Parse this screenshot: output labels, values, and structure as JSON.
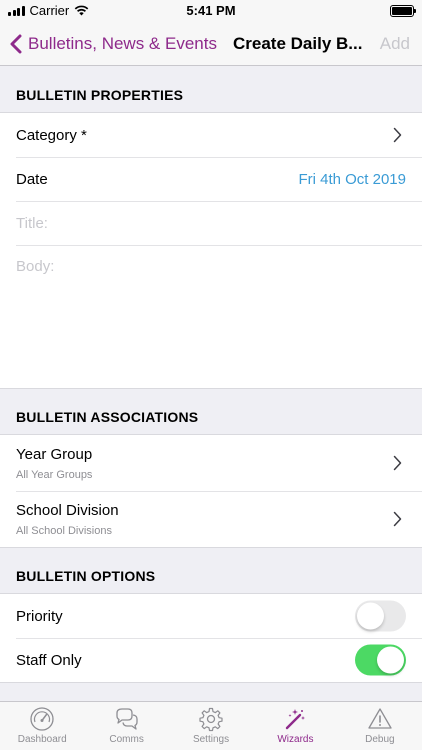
{
  "status_bar": {
    "carrier": "Carrier",
    "time": "5:41 PM"
  },
  "nav": {
    "back_label": "Bulletins, News & Events",
    "title": "Create Daily B...",
    "add_label": "Add"
  },
  "sections": {
    "properties": {
      "header": "BULLETIN PROPERTIES",
      "category_label": "Category *",
      "date_label": "Date",
      "date_value": "Fri 4th Oct 2019",
      "title_placeholder": "Title:",
      "body_placeholder": "Body:"
    },
    "associations": {
      "header": "BULLETIN ASSOCIATIONS",
      "year_group_label": "Year Group",
      "year_group_value": "All Year Groups",
      "school_division_label": "School Division",
      "school_division_value": "All School Divisions"
    },
    "options": {
      "header": "BULLETIN OPTIONS",
      "priority_label": "Priority",
      "priority_on": false,
      "staff_only_label": "Staff Only",
      "staff_only_on": true
    }
  },
  "tabs": [
    {
      "label": "Dashboard",
      "icon": "gauge-icon"
    },
    {
      "label": "Comms",
      "icon": "chat-bubbles-icon"
    },
    {
      "label": "Settings",
      "icon": "gear-icon"
    },
    {
      "label": "Wizards",
      "icon": "magic-wand-icon",
      "active": true
    },
    {
      "label": "Debug",
      "icon": "warning-icon"
    }
  ],
  "colors": {
    "accent": "#8e2a8b",
    "date_value": "#3a9bd5",
    "toggle_on": "#4cd964"
  }
}
